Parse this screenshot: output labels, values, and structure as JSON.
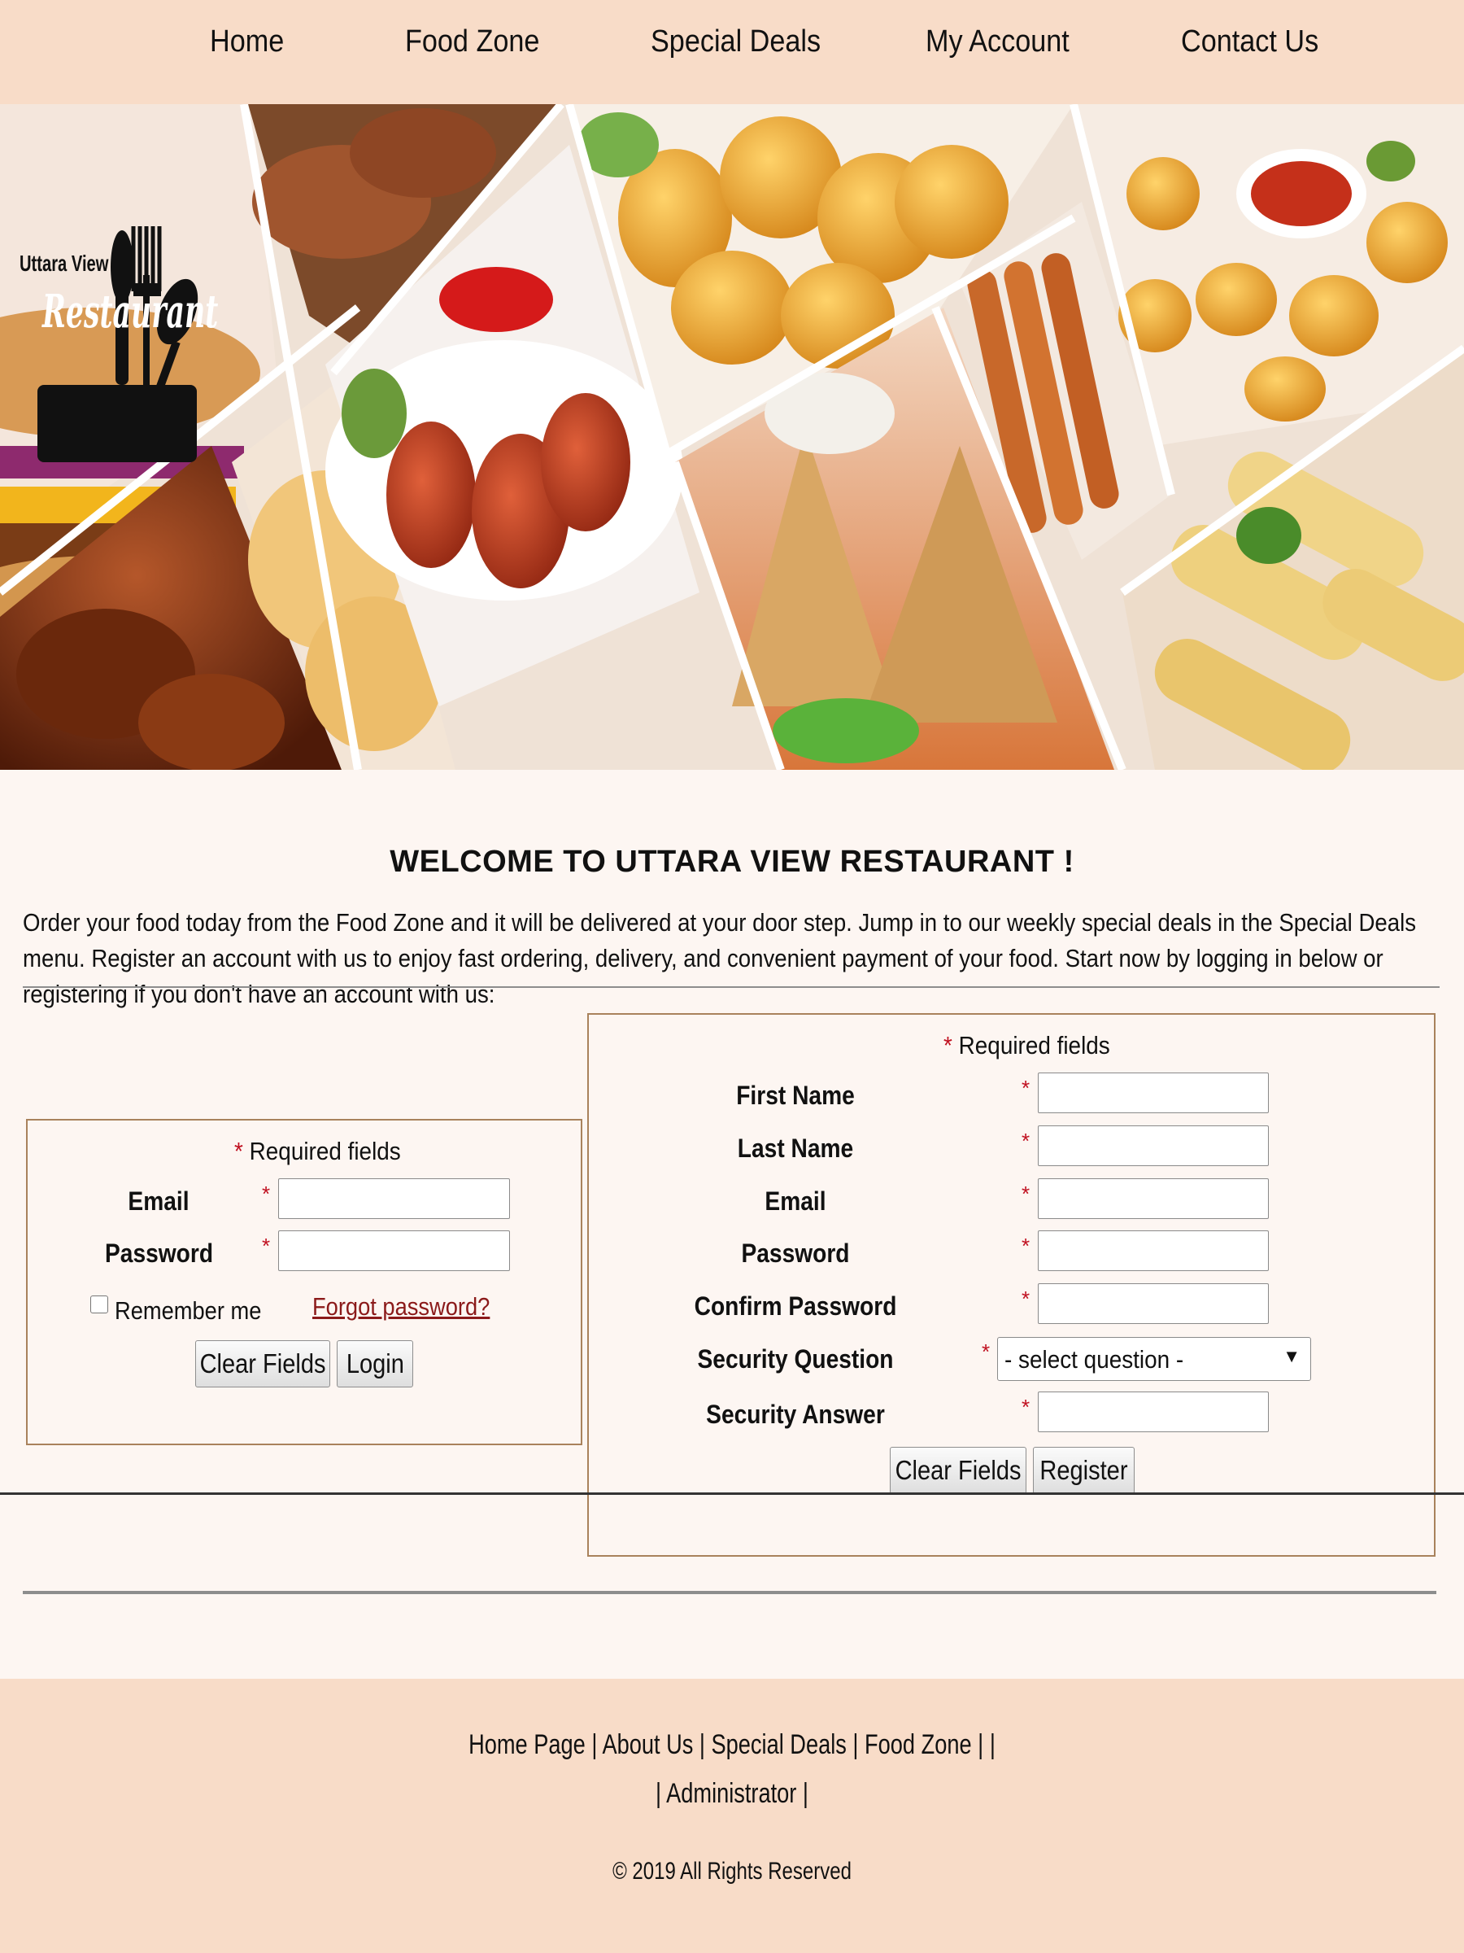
{
  "nav": {
    "items": [
      {
        "label": "Home"
      },
      {
        "label": "Food Zone"
      },
      {
        "label": "Special Deals"
      },
      {
        "label": "My Account"
      },
      {
        "label": "Contact Us"
      }
    ]
  },
  "banner": {
    "logo_small": "Uttara View",
    "logo_big": "Restaurant"
  },
  "welcome": {
    "title": "WELCOME TO UTTARA VIEW RESTAURANT !",
    "intro": "Order your food today from the Food Zone and it will be delivered at your door step. Jump in to our weekly special deals in the Special Deals menu. Register an account with us to enjoy fast ordering, delivery, and convenient payment of your food. Start now by logging in below or registering if you don't have an account with us:"
  },
  "login": {
    "required_star": "*",
    "required_note": "Required fields",
    "email_label": "Email",
    "password_label": "Password",
    "email_value": "",
    "password_value": "",
    "remember_label": "Remember me",
    "remember_checked": false,
    "forgot_link": "Forgot password?",
    "clear_button": "Clear Fields",
    "login_button": "Login"
  },
  "register": {
    "required_star": "*",
    "required_note": "Required fields",
    "fields": [
      {
        "label": "First Name",
        "value": ""
      },
      {
        "label": "Last Name",
        "value": ""
      },
      {
        "label": "Email",
        "value": ""
      },
      {
        "label": "Password",
        "value": ""
      },
      {
        "label": "Confirm Password",
        "value": ""
      },
      {
        "label": "Security Question",
        "value": "- select question -"
      },
      {
        "label": "Security Answer",
        "value": ""
      }
    ],
    "clear_button": "Clear Fields",
    "register_button": "Register"
  },
  "footer": {
    "links": [
      "Home Page",
      "About Us",
      "Special Deals",
      "Food Zone",
      "Administrator"
    ],
    "separator": "|",
    "copyright": "© 2019 All Rights Reserved"
  },
  "colors": {
    "nav_bg": "#f8dcc8",
    "page_bg": "#fdf6f2",
    "form_border": "#a9825c",
    "required_star": "#c01020",
    "link": "#8b1a1a"
  }
}
